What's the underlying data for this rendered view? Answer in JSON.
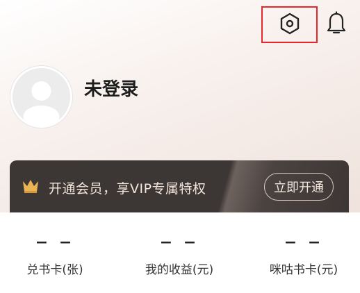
{
  "header": {
    "settings_icon": "settings-hexagon-icon",
    "bell_icon": "bell-icon"
  },
  "profile": {
    "username": "未登录",
    "avatar_icon": "default-avatar-icon"
  },
  "vip_banner": {
    "text": "开通会员，享VIP专属特权",
    "button_label": "立即开通",
    "crown_icon": "crown-icon"
  },
  "stats": {
    "items": [
      {
        "value": "− −",
        "label": "兑书卡(张)"
      },
      {
        "value": "− −",
        "label": "我的收益(元)"
      },
      {
        "value": "− −",
        "label": "咪咕书卡(元)"
      }
    ]
  },
  "colors": {
    "highlight_border": "#e8262b",
    "vip_banner_bg": "#3c3634",
    "vip_text": "#f3e6dc"
  }
}
